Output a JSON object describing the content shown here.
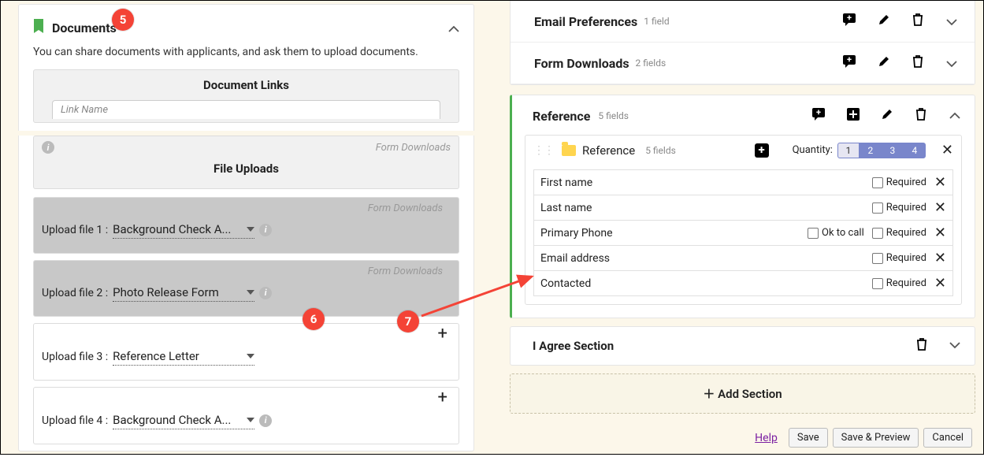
{
  "annotations": {
    "a5": "5",
    "a6": "6",
    "a7": "7"
  },
  "left": {
    "section_title": "Documents",
    "desc": "You can share documents with applicants, and ask them to upload documents.",
    "doc_links_head": "Document Links",
    "link_name_placeholder": "Link Name",
    "form_downloads_label": "Form Downloads",
    "file_uploads_head": "File Uploads",
    "uploads": [
      {
        "label": "Upload file 1 :",
        "value": "Background Check A...",
        "info": true,
        "bg": "grey",
        "plus": false,
        "fd": true
      },
      {
        "label": "Upload file 2 :",
        "value": "Photo Release Form",
        "info": true,
        "bg": "grey",
        "plus": false,
        "fd": true
      },
      {
        "label": "Upload file 3 :",
        "value": "Reference Letter",
        "info": false,
        "bg": "white",
        "plus": true,
        "fd": false
      },
      {
        "label": "Upload file 4 :",
        "value": "Background Check A...",
        "info": true,
        "bg": "white",
        "plus": true,
        "fd": false
      }
    ]
  },
  "right": {
    "sections_top": [
      {
        "title": "Email Preferences",
        "count_label": "1 field"
      },
      {
        "title": "Form Downloads",
        "count_label": "2 fields"
      }
    ],
    "reference": {
      "title": "Reference",
      "count_label": "5 fields",
      "inner_title": "Reference",
      "inner_count": "5 fields",
      "quantity_label": "Quantity:",
      "quantities": [
        "1",
        "2",
        "3",
        "4"
      ],
      "fields": [
        {
          "name": "First name",
          "ok_call": false
        },
        {
          "name": "Last name",
          "ok_call": false
        },
        {
          "name": "Primary Phone",
          "ok_call": true
        },
        {
          "name": "Email address",
          "ok_call": false
        },
        {
          "name": "Contacted",
          "ok_call": false
        }
      ],
      "ok_to_call_label": "Ok to call",
      "required_label": "Required"
    },
    "iagree_title": "I Agree Section",
    "add_section_label": "Add Section",
    "buttons": {
      "help": "Help",
      "save": "Save",
      "save_preview": "Save & Preview",
      "cancel": "Cancel"
    }
  },
  "colors": {
    "accent_green": "#4caf50",
    "badge_red": "#f44336",
    "qty_purple": "#7986cb"
  }
}
